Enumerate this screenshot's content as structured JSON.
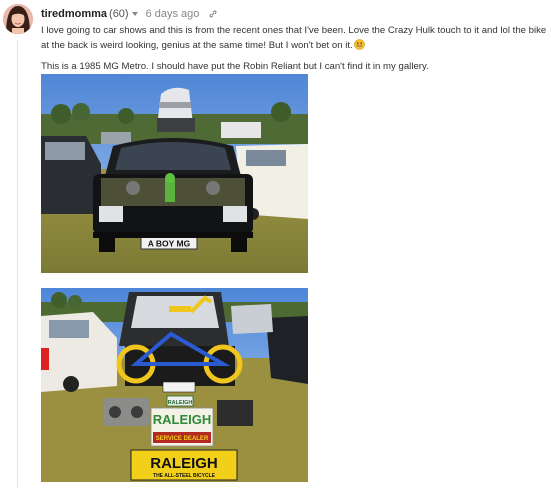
{
  "comment": {
    "author": "tiredmomma",
    "reputation": "(60)",
    "time": "6 days ago",
    "paragraph1": "I love going to car shows and this is from the recent ones that I've been. Love the Crazy Hulk touch to it and lol the bike at the back is weird looking, genius at the same time! But I won't bet on it.",
    "paragraph2": "This is a 1985 MG Metro. I should have put the Robin Reliant but I can't find it in my gallery."
  },
  "photos": {
    "photo1_plate": "A BOY MG",
    "photo2_sign1_title": "RALEIGH",
    "photo2_sign1_sub": "SERVICE DEALER",
    "photo2_sign2_title": "RALEIGH",
    "photo2_sign2_sub": "THE ALL-STEEL BICYCLE",
    "photo2_small_sign": "RALEIGH"
  },
  "icons": {
    "menu": "chevron-down-icon",
    "permalink": "link-icon",
    "emoji": "grin-emoji-icon"
  },
  "colors": {
    "sky": "#5a8fd8",
    "grass": "#9a8f3e",
    "car_black": "#1f1f1f",
    "raleigh_yellow": "#f2d01a",
    "raleigh_green": "#2f8a3a"
  }
}
